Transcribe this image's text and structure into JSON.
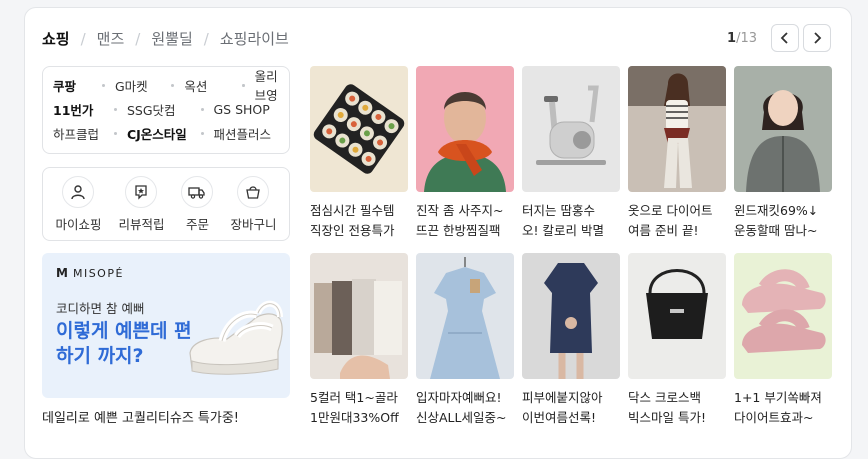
{
  "tabs": [
    {
      "label": "쇼핑",
      "active": true
    },
    {
      "label": "맨즈",
      "active": false
    },
    {
      "label": "원뿔딜",
      "active": false
    },
    {
      "label": "쇼핑라이브",
      "active": false
    }
  ],
  "pager": {
    "current": "1",
    "total": "/13",
    "prev_icon": "chevron-left-icon",
    "next_icon": "chevron-right-icon"
  },
  "malls": [
    [
      {
        "label": "쿠팡",
        "bold": true
      },
      {
        "label": "G마켓",
        "bold": false
      },
      {
        "label": "옥션",
        "bold": false
      },
      {
        "label": "올리브영",
        "bold": false
      }
    ],
    [
      {
        "label": "11번가",
        "bold": true
      },
      {
        "label": "SSG닷컴",
        "bold": false
      },
      {
        "label": "GS SHOP",
        "bold": false
      }
    ],
    [
      {
        "label": "하프클럽",
        "bold": false
      },
      {
        "label": "CJ온스타일",
        "bold": true
      },
      {
        "label": "패션플러스",
        "bold": false
      }
    ]
  ],
  "my_menu": [
    {
      "label": "마이쇼핑",
      "icon": "person-icon"
    },
    {
      "label": "리뷰적립",
      "icon": "review-star-icon"
    },
    {
      "label": "주문",
      "icon": "truck-icon"
    },
    {
      "label": "장바구니",
      "icon": "basket-icon"
    }
  ],
  "ad": {
    "brand_mark": "M",
    "brand": "MISOPÉ",
    "subtitle": "코디하면 참 예뻐",
    "headline": "이렇게 예쁜데 편하기 까지?",
    "caption": "데일리로 예쁜 고퀄리티슈즈 특가중!"
  },
  "products": [
    {
      "title": "점심시간 필수템\n직장인 전용특가",
      "bg": "#efe6d3"
    },
    {
      "title": "진작 좀 사주지~\n뜨끈 한방찜질팩",
      "bg": "#f1a8b4"
    },
    {
      "title": "터지는 땀홍수\n오! 칼로리 박멸",
      "bg": "#e6e6e6"
    },
    {
      "title": "옷으로 다이어트\n여름 준비 끝!",
      "bg": "#c9bfb5"
    },
    {
      "title": "윈드재킷69%↓\n운동할때 땀나~",
      "bg": "#a8b0a8"
    },
    {
      "title": "5컬러 택1~골라\n1만원대33%Off",
      "bg": "#e8e2dc"
    },
    {
      "title": "입자마자예뻐요!\n신상ALL세일중~",
      "bg": "#a7c1db"
    },
    {
      "title": "피부에붙지않아\n이번여름선록!",
      "bg": "#d9d9d9"
    },
    {
      "title": "닥스 크로스백\n빅스마일 특가!",
      "bg": "#ececea"
    },
    {
      "title": "1+1 부기쏙빠져\n다이어트효과~",
      "bg": "#e9f2d6"
    }
  ]
}
